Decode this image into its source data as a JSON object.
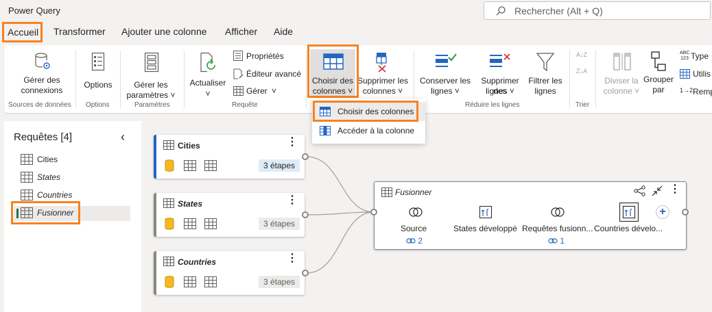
{
  "app": {
    "title": "Power Query"
  },
  "search": {
    "placeholder": "Rechercher (Alt + Q)"
  },
  "tabs": [
    {
      "label": "Accueil"
    },
    {
      "label": "Transformer"
    },
    {
      "label": "Ajouter une colonne"
    },
    {
      "label": "Afficher"
    },
    {
      "label": "Aide"
    }
  ],
  "ribbon": {
    "manage_connections": {
      "line1": "Gérer des",
      "line2": "connexions"
    },
    "options": {
      "label": "Options"
    },
    "manage_params": {
      "line1": "Gérer les",
      "line2": "paramètres"
    },
    "refresh": {
      "label": "Actualiser"
    },
    "properties": {
      "label": "Propriétés"
    },
    "advanced_editor": {
      "label": "Éditeur avancé"
    },
    "manage": {
      "label": "Gérer"
    },
    "choose_columns": {
      "line1": "Choisir des",
      "line2": "colonnes"
    },
    "remove_columns": {
      "line1": "Supprimer les",
      "line2": "colonnes"
    },
    "keep_rows": {
      "line1": "Conserver les",
      "line2": "lignes"
    },
    "remove_rows": {
      "line1": "Supprimer des",
      "line2": "lignes"
    },
    "filter_rows": {
      "line1": "Filtrer les",
      "line2": "lignes"
    },
    "split_column": {
      "line1": "Diviser la",
      "line2": "colonne"
    },
    "group_by": {
      "line1": "Grouper",
      "line2": "par"
    },
    "type": {
      "label": "Type"
    },
    "use": {
      "label": "Utilis"
    },
    "replace": {
      "label": "Remp"
    },
    "abc_top": "ABC",
    "abc_bottom": "123",
    "replace_digits": "1→2",
    "sort_az": "A↓Z",
    "sort_za": "Z↓A",
    "groups": {
      "data_sources": "Sources de données",
      "options": "Options",
      "parameters": "Paramètres",
      "query": "Requête",
      "reduce_rows": "Réduire les lignes",
      "sort": "Trier"
    }
  },
  "dropdown": {
    "items": [
      {
        "label": "Choisir des colonnes"
      },
      {
        "label": "Accéder à la colonne"
      }
    ]
  },
  "queries_panel": {
    "title": "Requêtes [4]",
    "items": [
      {
        "label": "Cities"
      },
      {
        "label": "States"
      },
      {
        "label": "Countries"
      },
      {
        "label": "Fusionner"
      }
    ]
  },
  "diagram": {
    "cards": [
      {
        "title": "Cities",
        "steps": "3 étapes"
      },
      {
        "title": "States",
        "steps": "3 étapes"
      },
      {
        "title": "Countries",
        "steps": "3 étapes"
      }
    ],
    "merge": {
      "title": "Fusionner",
      "steps": [
        {
          "label": "Source",
          "links": "2"
        },
        {
          "label": "States développé"
        },
        {
          "label": "Requêtes fusionn...",
          "links": "1"
        },
        {
          "label": "Countries dévelo..."
        }
      ]
    }
  },
  "colors": {
    "highlight": "#f7821f",
    "accent_blue": "#2266c2",
    "icon_gold": "#f5b722",
    "selected_bar": "#217346"
  }
}
